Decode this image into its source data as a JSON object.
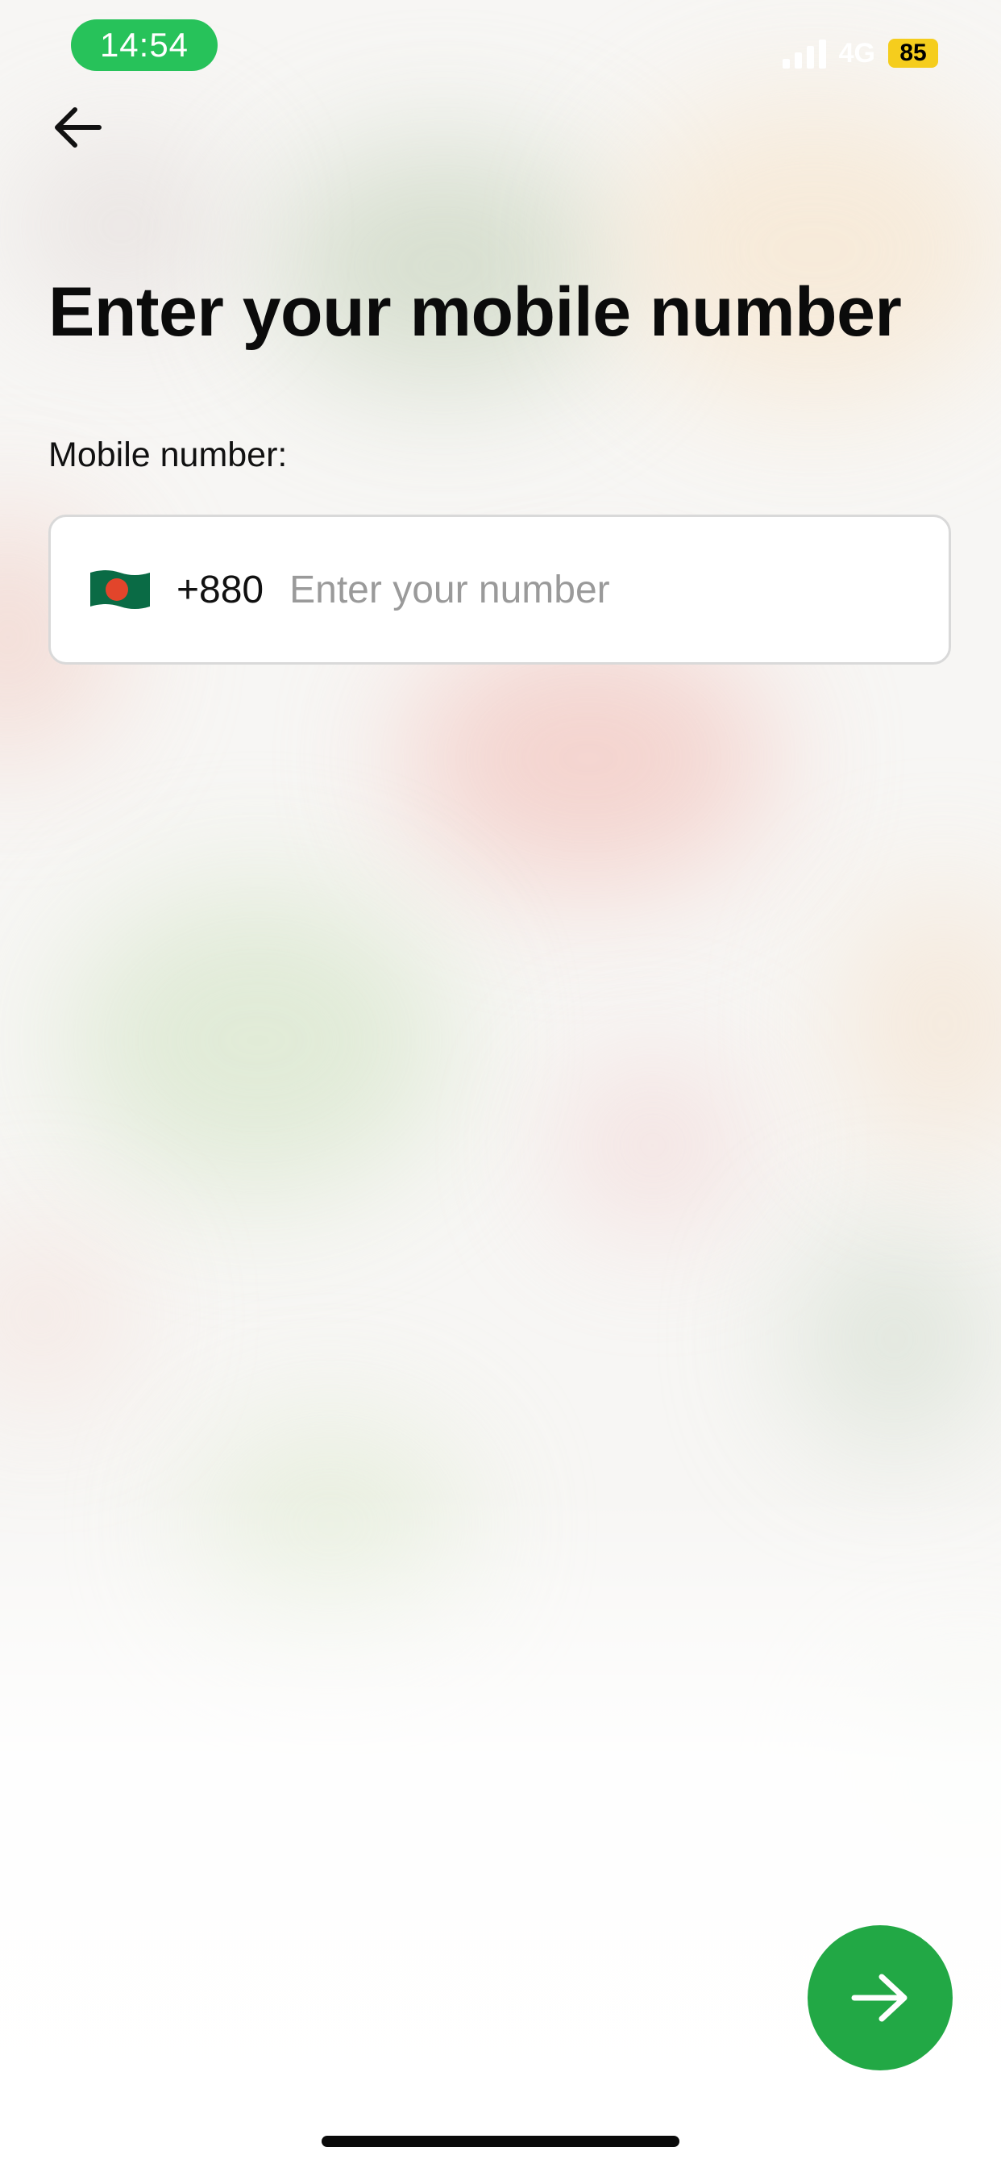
{
  "status_bar": {
    "time": "14:54",
    "network": "4G",
    "battery": "85"
  },
  "header": {
    "back_icon": "arrow-left-icon"
  },
  "title": "Enter your mobile number",
  "phone": {
    "label": "Mobile number:",
    "flag_icon": "bangladesh-flag-icon",
    "country_code": "+880",
    "value": "",
    "placeholder": "Enter your number"
  },
  "actions": {
    "next_icon": "arrow-right-icon"
  },
  "colors": {
    "accent": "#22A845",
    "time_pill": "#27C25A",
    "battery": "#F5CD1D"
  }
}
